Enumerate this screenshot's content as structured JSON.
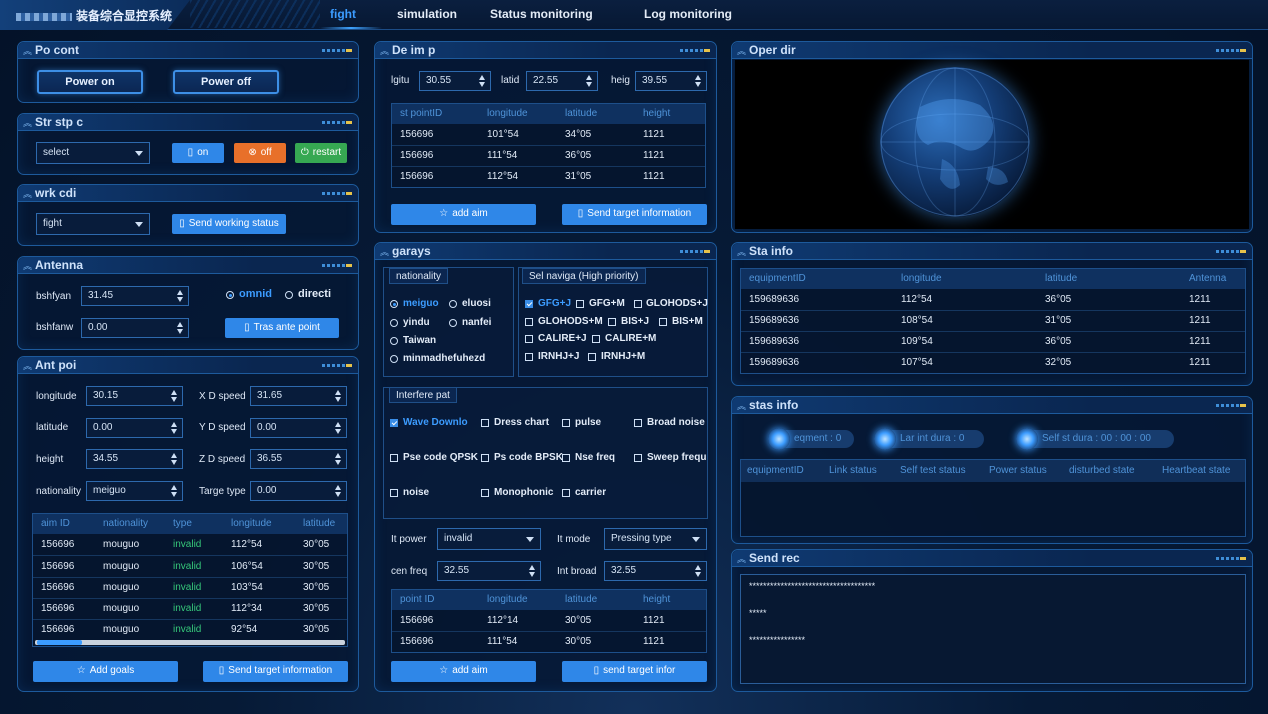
{
  "app": {
    "title": "装备综合显控系统"
  },
  "nav": {
    "tabs": [
      "fight",
      "simulation",
      "Status monitoring",
      "Log monitoring"
    ]
  },
  "power": {
    "title": "Po cont",
    "on_label": "Power on",
    "off_label": "Power off"
  },
  "strategy": {
    "title": "Str stp c",
    "select_value": "select",
    "on_label": "on",
    "off_label": "off",
    "restart_label": "restart"
  },
  "working": {
    "title": "wrk cdi",
    "select_value": "fight",
    "send_label": "Send working status"
  },
  "antenna": {
    "title": "Antenna",
    "az_label": "bshfyan",
    "az_value": "31.45",
    "pitch_label": "bshfanw",
    "pitch_value": "0.00",
    "mode_omni": "omnid",
    "mode_direct": "directi",
    "trans_label": "Tras ante point"
  },
  "antpoint": {
    "title": "Ant poi",
    "fields": {
      "longitude_label": "longitude",
      "longitude_value": "30.15",
      "latitude_label": "latitude",
      "latitude_value": "0.00",
      "height_label": "height",
      "height_value": "34.55",
      "nationality_label": "nationality",
      "nationality_value": "meiguo",
      "xspeed_label": "X D speed",
      "xspeed_value": "31.65",
      "yspeed_label": "Y D speed",
      "yspeed_value": "0.00",
      "zspeed_label": "Z D speed",
      "zspeed_value": "36.55",
      "targetype_label": "Targe type",
      "targetype_value": "0.00"
    },
    "table": {
      "headers": [
        "aim ID",
        "nationality",
        "type",
        "longitude",
        "latitude"
      ],
      "rows": [
        [
          "156696",
          "mouguo",
          "invalid",
          "112°54",
          "30°05"
        ],
        [
          "156696",
          "mouguo",
          "invalid",
          "106°54",
          "30°05"
        ],
        [
          "156696",
          "mouguo",
          "invalid",
          "103°54",
          "30°05"
        ],
        [
          "156696",
          "mouguo",
          "invalid",
          "112°34",
          "30°05"
        ],
        [
          "156696",
          "mouguo",
          "invalid",
          "92°54",
          "30°05"
        ]
      ]
    },
    "add_label": "Add goals",
    "send_label": "Send target information"
  },
  "deimp": {
    "title": "De im p",
    "lng_label": "lgitu",
    "lng_value": "30.55",
    "lat_label": "latid",
    "lat_value": "22.55",
    "h_label": "heig",
    "h_value": "39.55",
    "table": {
      "headers": [
        "st pointID",
        "longitude",
        "latitude",
        "height"
      ],
      "rows": [
        [
          "156696",
          "101°54",
          "34°05",
          "1121"
        ],
        [
          "156696",
          "111°54",
          "36°05",
          "1121"
        ],
        [
          "156696",
          "112°54",
          "31°05",
          "1121"
        ]
      ]
    },
    "add_label": "add aim",
    "send_label": "Send target information"
  },
  "garays": {
    "title": "garays",
    "nationality_title": "nationality",
    "nationalities": [
      "meiguo",
      "eluosi",
      "yindu",
      "nanfei",
      "Taiwan",
      "minmadhefuhezd"
    ],
    "nav_title": "Sel naviga (High priority)",
    "navs": [
      "GFG+J",
      "GFG+M",
      "GLOHODS+J",
      "GLOHODS+M",
      "BIS+J",
      "BIS+M",
      "CALIRE+J",
      "CALIRE+M",
      "IRNHJ+J",
      "IRNHJ+M"
    ],
    "interfere_title": "Interfere pat",
    "interferes": [
      "Wave Downlo",
      "Dress chart",
      "pulse",
      "Broad noise",
      "Pse code QPSK",
      "Ps code BPSK",
      "Nse freq",
      "Sweep frequ",
      "noise",
      "Monophonic",
      "carrier"
    ],
    "power_label": "It power",
    "power_value": "invalid",
    "mode_label": "It mode",
    "mode_value": "Pressing type",
    "freq_label": "cen freq",
    "freq_value": "32.55",
    "broad_label": "Int broad",
    "broad_value": "32.55",
    "table": {
      "headers": [
        "point ID",
        "longitude",
        "latitude",
        "height"
      ],
      "rows": [
        [
          "156696",
          "112°14",
          "30°05",
          "1121"
        ],
        [
          "156696",
          "111°54",
          "30°05",
          "1121"
        ]
      ]
    },
    "add_label": "add aim",
    "send_label": "send target infor"
  },
  "oper": {
    "title": "Oper dir"
  },
  "stainfo": {
    "title": "Sta info",
    "table": {
      "headers": [
        "equipmentID",
        "longitude",
        "latitude",
        "Antenna"
      ],
      "rows": [
        [
          "159689636",
          "112°54",
          "36°05",
          "1211"
        ],
        [
          "159689636",
          "108°54",
          "31°05",
          "1211"
        ],
        [
          "159689636",
          "109°54",
          "36°05",
          "1211"
        ],
        [
          "159689636",
          "107°54",
          "32°05",
          "1211"
        ]
      ]
    }
  },
  "stas": {
    "title": "stas info",
    "pills": [
      "eqment : 0",
      "Lar int dura : 0",
      "Self st dura : 00 : 00 : 00"
    ],
    "headers": [
      "equipmentID",
      "Link status",
      "Self test status",
      "Power status",
      "disturbed state",
      "Heartbeat state"
    ]
  },
  "sendrec": {
    "title": "Send rec",
    "lines": [
      "************************************",
      "*****",
      "****************"
    ]
  },
  "colors": {
    "accent": "#3c9cff",
    "panel_border": "#1d5a9c",
    "ok": "#36c87a",
    "warn": "#e8702a"
  }
}
